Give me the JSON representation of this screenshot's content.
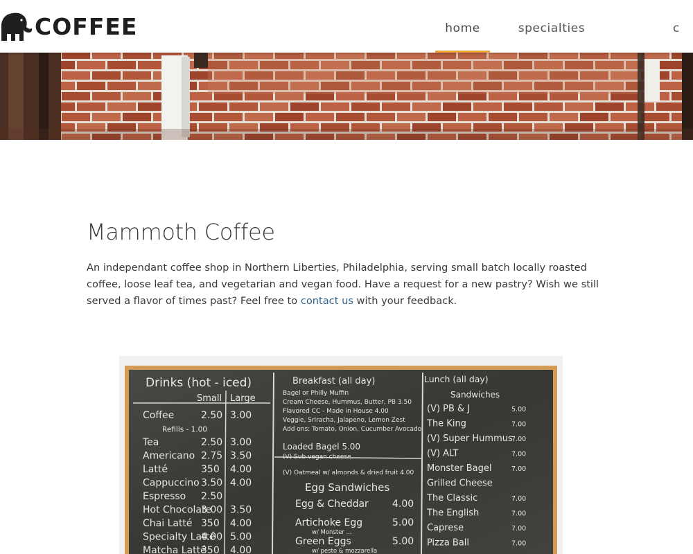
{
  "header": {
    "logo_text": "COFFEE",
    "nav": [
      {
        "label": "home",
        "active": true
      },
      {
        "label": "specialties",
        "active": false
      },
      {
        "label": "c",
        "active": false
      }
    ]
  },
  "main": {
    "title": "Mammoth Coffee",
    "description_before_link": "An independant coffee shop in Northern Liberties, Philadelphia, serving small batch locally roasted coffee, loose leaf tea, and vegetarian and vegan food. Have a request for a new pastry? Wish we still served a flavor of times past? Feel free to ",
    "description_link": "contact us",
    "description_after_link": " with your feedback."
  },
  "menu_board": {
    "drinks": {
      "heading": "Drinks (hot - iced)",
      "col_small": "Small",
      "col_large": "Large",
      "items": [
        {
          "name": "Coffee",
          "small": "2.50",
          "large": "3.00"
        },
        {
          "name": "Refills - 1.00",
          "small": "",
          "large": ""
        },
        {
          "name": "Tea",
          "small": "2.50",
          "large": "3.00"
        },
        {
          "name": "Americano",
          "small": "2.75",
          "large": "3.50"
        },
        {
          "name": "Latté",
          "small": "350",
          "large": "4.00"
        },
        {
          "name": "Cappuccino",
          "small": "3.50",
          "large": "4.00"
        },
        {
          "name": "Espresso",
          "small": "2.50",
          "large": ""
        },
        {
          "name": "Hot Chocolate",
          "small": "3.00",
          "large": "3.50"
        },
        {
          "name": "Chai Latté",
          "small": "350",
          "large": "4.00"
        },
        {
          "name": "Specialty Latté",
          "small": "4.00",
          "large": "5.00"
        },
        {
          "name": "Matcha Latté",
          "small": "350",
          "large": "4.00"
        }
      ]
    },
    "breakfast": {
      "heading": "Breakfast (all day)",
      "lines": [
        "Bagel or Philly Muffin",
        "Cream Cheese, Hummus, Butter, PB  3.50",
        "Flavored CC - Made in House  4.00",
        "Veggie, Sriracha, Jalapeno, Lemon Zest",
        "Add ons: Tomato, Onion, Cucumber  Avocado",
        "Loaded Bagel  5.00",
        "(V) Sub vegan cheese",
        "(V) Oatmeal w/ almonds & dried fruit  4.00"
      ],
      "egg_heading": "Egg Sandwiches",
      "egg_items": [
        {
          "name": "Egg & Cheddar",
          "price": "4.00"
        },
        {
          "name": "Artichoke Egg",
          "price": "5.00"
        },
        {
          "name": "Green Eggs",
          "price": "5.00"
        }
      ],
      "egg_notes": [
        "w/ Monster ...",
        "w/ pesto & mozzarella"
      ]
    },
    "lunch": {
      "heading": "Lunch (all day)",
      "subheading": "Sandwiches",
      "items": [
        {
          "name": "(V) PB & J",
          "price": "5.00"
        },
        {
          "name": "The King",
          "price": "7.00"
        },
        {
          "name": "(V) Super Hummus",
          "price": "7.00"
        },
        {
          "name": "(V) ALT",
          "price": "7.00"
        },
        {
          "name": "Monster Bagel",
          "price": "7.00"
        },
        {
          "name": "Grilled Cheese",
          "price": ""
        },
        {
          "name": "The Classic",
          "price": "7.00"
        },
        {
          "name": "The English",
          "price": "7.00"
        },
        {
          "name": "Caprese",
          "price": "7.00"
        },
        {
          "name": "Pizza Ball",
          "price": "7.00"
        }
      ]
    }
  }
}
